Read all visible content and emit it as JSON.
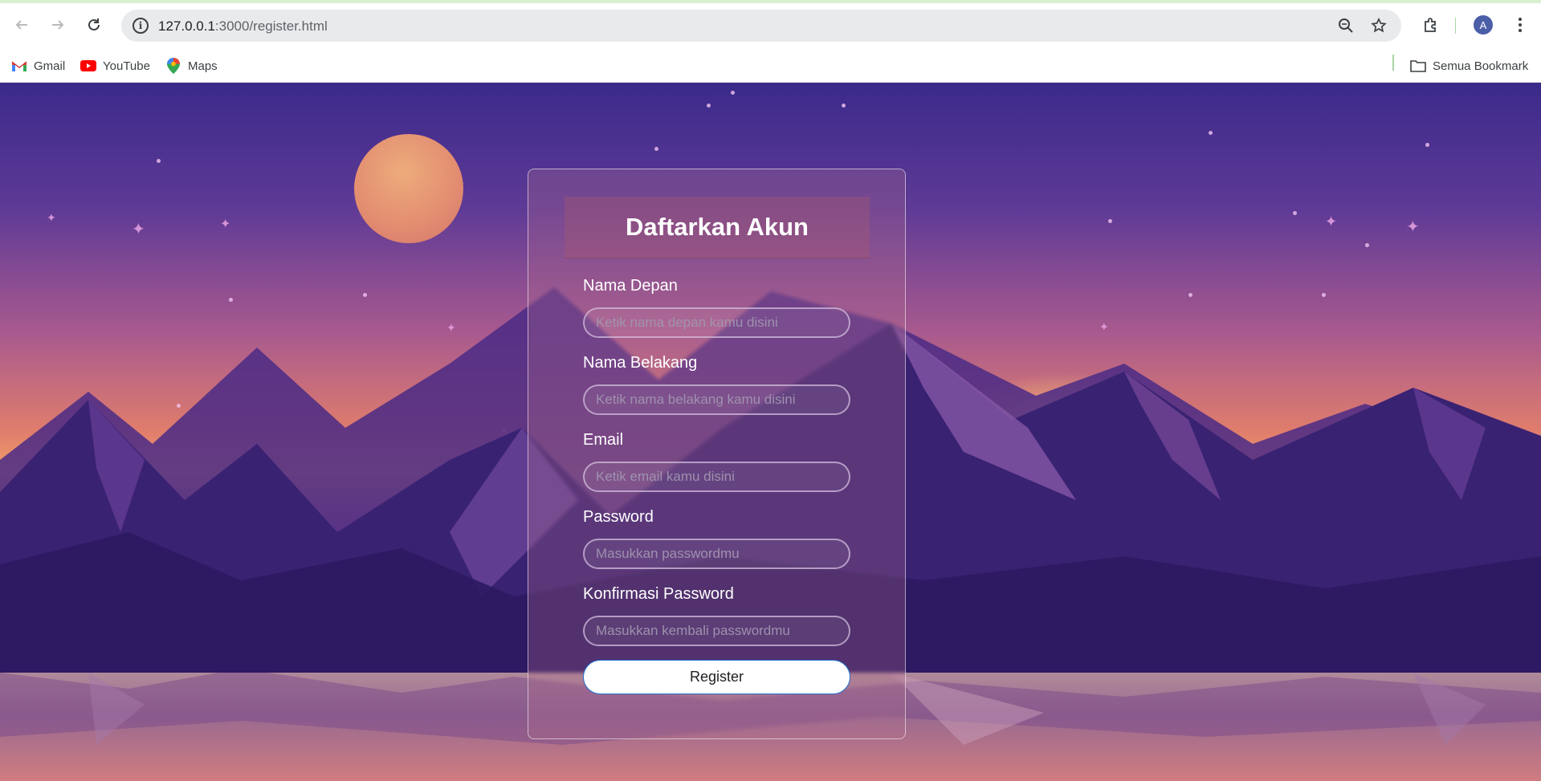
{
  "browser": {
    "url_host": "127.0.0.1",
    "url_path": ":3000/register.html",
    "profile_initial": "A",
    "bookmarks": [
      {
        "label": "Gmail",
        "icon": "gmail-icon"
      },
      {
        "label": "YouTube",
        "icon": "youtube-icon"
      },
      {
        "label": "Maps",
        "icon": "maps-icon"
      }
    ],
    "all_bookmarks_label": "Semua Bookmark"
  },
  "form": {
    "title": "Daftarkan Akun",
    "fields": [
      {
        "label": "Nama Depan",
        "placeholder": "Ketik nama depan kamu disini",
        "value": ""
      },
      {
        "label": "Nama Belakang",
        "placeholder": "Ketik nama belakang kamu disini",
        "value": ""
      },
      {
        "label": "Email",
        "placeholder": "Ketik email kamu disini",
        "value": ""
      },
      {
        "label": "Password",
        "placeholder": "Masukkan passwordmu",
        "value": ""
      },
      {
        "label": "Konfirmasi Password",
        "placeholder": "Masukkan kembali passwordmu",
        "value": ""
      }
    ],
    "submit_label": "Register"
  },
  "colors": {
    "accent_border": "#1e6fd0",
    "avatar_bg": "#4b5ea8"
  }
}
